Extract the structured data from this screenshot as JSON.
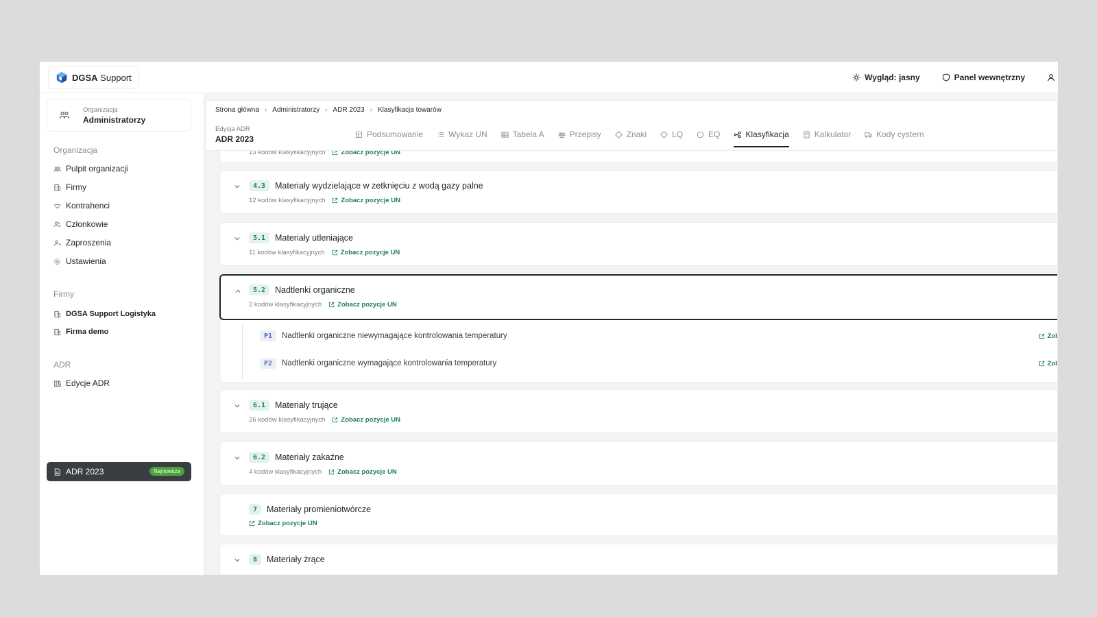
{
  "app": {
    "logo_bold": "DGSA",
    "logo_rest": " Support"
  },
  "topbar": {
    "theme": "Wygląd: jasny",
    "panel": "Panel wewnętrzny"
  },
  "sidebar": {
    "org_label": "Organizacja",
    "org_name": "Administratorzy",
    "sections": {
      "org": "Organizacja",
      "firms": "Firmy",
      "adr": "ADR"
    },
    "org_items": [
      {
        "label": "Pulpit organizacji",
        "icon": "users-icon"
      },
      {
        "label": "Firmy",
        "icon": "building-icon"
      },
      {
        "label": "Kontrahenci",
        "icon": "handshake-icon"
      },
      {
        "label": "Członkowie",
        "icon": "members-icon"
      },
      {
        "label": "Zaproszenia",
        "icon": "invite-icon"
      },
      {
        "label": "Ustawienia",
        "icon": "gear-icon"
      }
    ],
    "firm_items": [
      {
        "label": "DGSA Support Logistyka",
        "icon": "building-icon"
      },
      {
        "label": "Firma demo",
        "icon": "building-icon"
      }
    ],
    "adr_items": [
      {
        "label": "Edycje ADR",
        "icon": "books-icon"
      }
    ],
    "active_item": {
      "label": "ADR 2023",
      "badge": "Najnowsza"
    }
  },
  "breadcrumb": [
    "Strona główna",
    "Administratorzy",
    "ADR 2023",
    "Klasyfikacja towarów"
  ],
  "edition": {
    "label": "Edycja ADR",
    "name": "ADR 2023"
  },
  "tabs": [
    {
      "label": "Podsumowanie",
      "icon": "summary-icon"
    },
    {
      "label": "Wykaz UN",
      "icon": "list-icon"
    },
    {
      "label": "Tabela A",
      "icon": "table-icon"
    },
    {
      "label": "Przepisy",
      "icon": "scale-icon"
    },
    {
      "label": "Znaki",
      "icon": "diamond-icon"
    },
    {
      "label": "LQ",
      "icon": "diamond-outline-icon"
    },
    {
      "label": "EQ",
      "icon": "circle-icon"
    },
    {
      "label": "Klasyfikacja",
      "icon": "classification-icon",
      "active": true
    },
    {
      "label": "Kalkulator",
      "icon": "calculator-icon"
    },
    {
      "label": "Kody cystern",
      "icon": "truck-icon"
    }
  ],
  "link_label": "Zobacz pozycje UN",
  "partial_top": {
    "sub": "13 kodów klasyfikacyjnych"
  },
  "cards": [
    {
      "code": "4.3",
      "title": "Materiały wydzielające w zetknięciu z wodą gazy palne",
      "sub": "12 kodów klasyfikacyjnych"
    },
    {
      "code": "5.1",
      "title": "Materiały utleniające",
      "sub": "11 kodów klasyfikacyjnych"
    },
    {
      "code": "5.2",
      "title": "Nadtlenki organiczne",
      "sub": "2 kodów klasyfikacyjnych",
      "expanded": true
    },
    {
      "code": "6.1",
      "title": "Materiały trujące",
      "sub": "26 kodów klasyfikacyjnych"
    },
    {
      "code": "6.2",
      "title": "Materiały zakaźne",
      "sub": "4 kodów klasyfikacyjnych"
    },
    {
      "code": "7",
      "title": "Materiały promieniotwórcze"
    },
    {
      "code": "8",
      "title": "Materiały żrące"
    }
  ],
  "subitems": [
    {
      "code": "P1",
      "title": "Nadtlenki organiczne niewymagające kontrolowania temperatury",
      "link": "Zob"
    },
    {
      "code": "P2",
      "title": "Nadtlenki organiczne wymagające kontrolowania temperatury",
      "link": "Zob"
    }
  ],
  "colors": {
    "accent": "#1d7a64",
    "active_bg": "#3a3d42",
    "badge_new": "#4ba23a"
  }
}
